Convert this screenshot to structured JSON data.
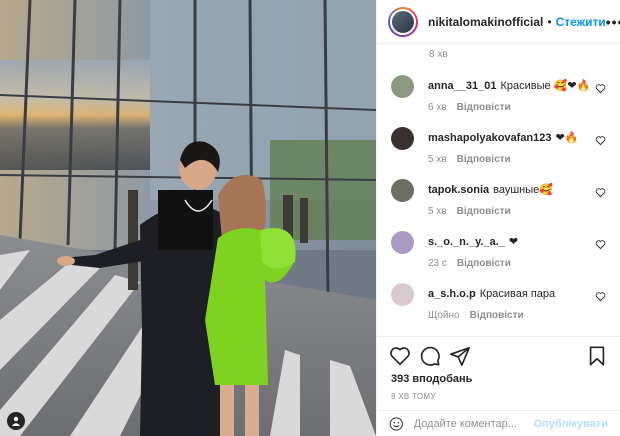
{
  "post": {
    "author": "nikitalomakinofficial",
    "follow_label": "Стежити",
    "more_label": "•••",
    "top_time": "8 хв"
  },
  "comments": [
    {
      "user": "anna__31_01",
      "text": "Красивые",
      "emoji": "🥰❤🔥",
      "time": "6 хв",
      "reply": "Відповісти",
      "avatar_color": "#8a9a7e"
    },
    {
      "user": "mashapolyakovafan123",
      "text": "",
      "emoji": "❤🔥",
      "time": "5 хв",
      "reply": "Відповісти",
      "avatar_color": "#3b3030"
    },
    {
      "user": "tapok.sonia",
      "text": "ваушные",
      "emoji": "🥰",
      "time": "5 хв",
      "reply": "Відповісти",
      "avatar_color": "#6b6f62"
    },
    {
      "user": "s._o._n._y._a._",
      "text": "",
      "emoji": "❤",
      "time": "23 с",
      "reply": "Відповісти",
      "avatar_color": "#a89ac2"
    },
    {
      "user": "a_s.h.o.p",
      "text": "Красивая пара",
      "emoji": "",
      "time": "Щойно",
      "reply": "Відповісти",
      "avatar_color": "#d8c9cf"
    }
  ],
  "stats": {
    "likes": "393 вподобань",
    "posted": "8 ХВ ТОМУ"
  },
  "composer": {
    "placeholder": "Додайте коментар...",
    "publish_label": "Опублікувати"
  },
  "icons": {
    "like": "heart-icon",
    "comment": "comment-icon",
    "share": "share-icon",
    "save": "bookmark-icon",
    "emoji": "emoji-icon",
    "user_tag": "user-tag-icon"
  },
  "colors": {
    "accent": "#0095f6",
    "accent_disabled": "#b2dffc",
    "dress": "#7ed321"
  }
}
